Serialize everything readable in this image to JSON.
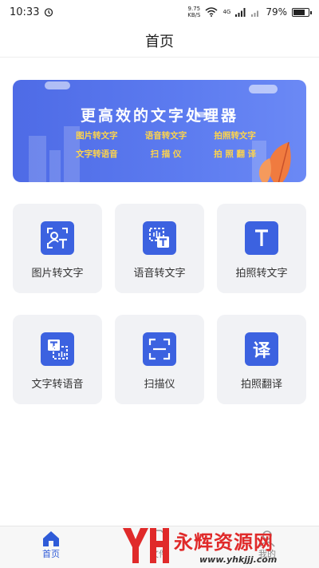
{
  "status_bar": {
    "time": "10:33",
    "net_speed_value": "9.75",
    "net_speed_unit": "KB/S",
    "signal_label": "4G",
    "battery": "79%",
    "battery_level": 0.79
  },
  "header": {
    "title": "首页"
  },
  "banner": {
    "title": "更高效的文字处理器",
    "features": [
      "图片转文字",
      "语音转文字",
      "拍照转文字",
      "文字转语音",
      "扫 描 仪",
      "拍 照 翻 译"
    ]
  },
  "tiles": [
    {
      "label": "图片转文字",
      "icon": "image-to-text-icon"
    },
    {
      "label": "语音转文字",
      "icon": "voice-to-text-icon"
    },
    {
      "label": "拍照转文字",
      "icon": "photo-to-text-icon"
    },
    {
      "label": "文字转语音",
      "icon": "text-to-voice-icon"
    },
    {
      "label": "扫描仪",
      "icon": "scanner-icon"
    },
    {
      "label": "拍照翻译",
      "icon": "translate-icon"
    }
  ],
  "bottom_nav": {
    "items": [
      {
        "label": "首页",
        "icon": "home-icon",
        "active": true
      },
      {
        "label": "文件",
        "icon": "file-icon",
        "active": false
      },
      {
        "label": "我的",
        "icon": "profile-icon",
        "active": false
      }
    ]
  },
  "watermark": {
    "brand": "永辉资源网",
    "url": "www.yhkjjj.com"
  },
  "colors": {
    "accent": "#3c62e0",
    "banner_bg": "#5a78ee",
    "banner_text": "#ffd54a",
    "tile_bg": "#f1f2f5",
    "watermark_red": "#e02a2a"
  }
}
